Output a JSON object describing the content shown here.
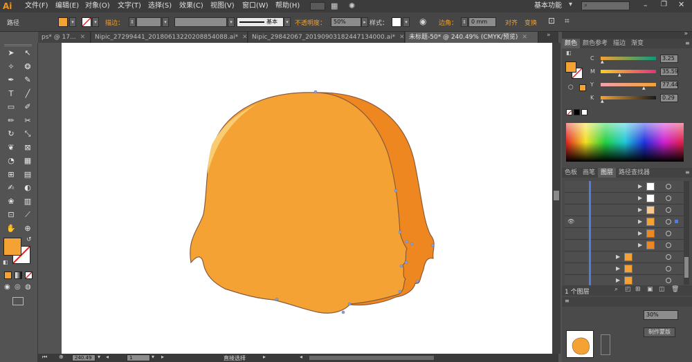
{
  "app": {
    "logo": "Ai",
    "workspace": "基本功能"
  },
  "menu": [
    "文件(F)",
    "编辑(E)",
    "对象(O)",
    "文字(T)",
    "选择(S)",
    "效果(C)",
    "视图(V)",
    "窗口(W)",
    "帮助(H)"
  ],
  "control": {
    "selection_label": "路径",
    "stroke_label": "描边：",
    "brush_label": "基本",
    "opacity_label": "不透明度：",
    "opacity_value": "50%",
    "style_label": "样式：",
    "corner_label": "边角：",
    "corner_value": "0 mm",
    "align_label": "对齐",
    "transform_label": "变换",
    "fill_color": "#f4a234"
  },
  "tabs": [
    {
      "label": "ps* @ 17...",
      "active": false
    },
    {
      "label": "Nipic_27299441_20180613220208854088.ai*",
      "active": false
    },
    {
      "label": "Nipic_29842067_20190903182447134000.ai*",
      "active": false
    },
    {
      "label": "未标题-50* @ 240.49% (CMYK/预览)",
      "active": true
    }
  ],
  "panels": {
    "color_tabs": [
      "颜色",
      "颜色参考",
      "描边",
      "渐变"
    ],
    "cmyk": [
      {
        "label": "C",
        "value": "3.25"
      },
      {
        "label": "M",
        "value": "35.59"
      },
      {
        "label": "Y",
        "value": "77.44"
      },
      {
        "label": "K",
        "value": "0.29"
      }
    ],
    "layer_tabs": [
      "色板",
      "画笔",
      "图层",
      "路径查找器"
    ],
    "layers_count": "1 个图层",
    "mask_button": "制作蒙版",
    "transparency_value": "30%"
  },
  "statusbar": {
    "zoom": "240.49",
    "page": "1",
    "tool": "直接选择"
  },
  "colors": {
    "hair_main": "#f4a234",
    "hair_shadow": "#ee8720",
    "hair_highlight": "#f8cc70",
    "outline": "#8a5a3c"
  },
  "icons": {
    "tools": [
      "selection-icon",
      "direct-selection-icon",
      "magic-wand-icon",
      "lasso-icon",
      "pen-icon",
      "curvature-icon",
      "type-icon",
      "line-icon",
      "rectangle-icon",
      "paintbrush-icon",
      "pencil-icon",
      "eraser-icon",
      "rotate-icon",
      "scale-icon",
      "warp-icon",
      "free-transform-icon",
      "shape-builder-icon",
      "perspective-icon",
      "mesh-icon",
      "gradient-icon",
      "eyedropper-icon",
      "blend-icon",
      "symbol-sprayer-icon",
      "column-graph-icon",
      "artboard-icon",
      "slice-icon",
      "hand-icon",
      "zoom-icon"
    ]
  }
}
